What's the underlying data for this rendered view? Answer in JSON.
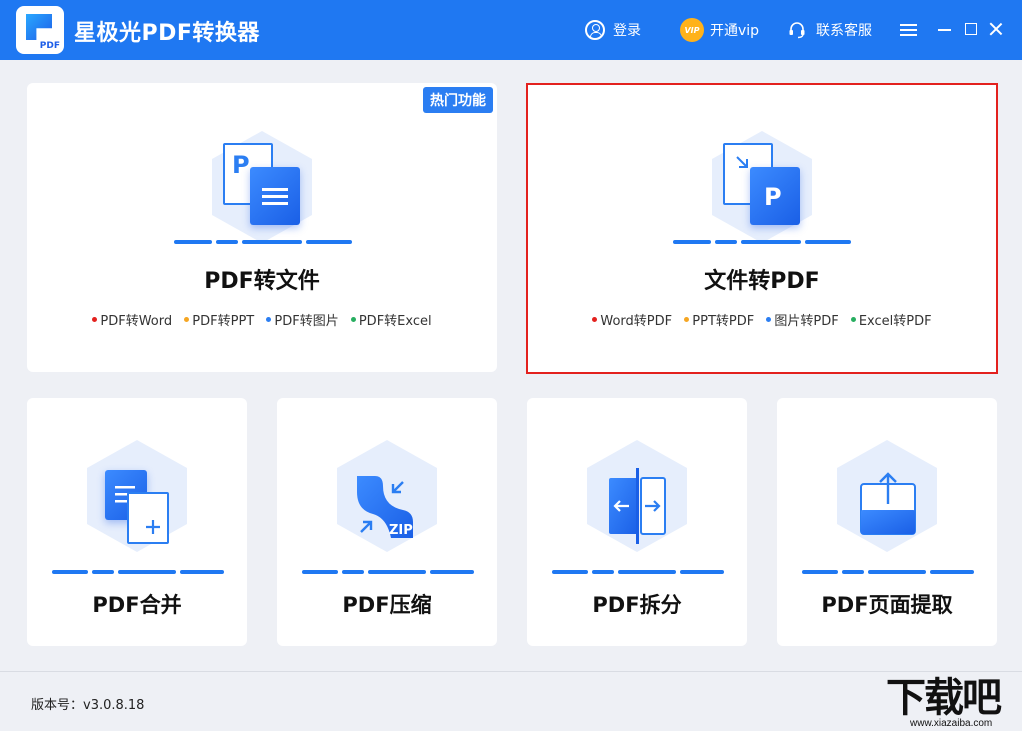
{
  "app": {
    "title": "星极光PDF转换器",
    "logo_text": "PDF"
  },
  "titlebar": {
    "login_label": "登录",
    "vip_badge": "VIP",
    "vip_label": "开通vip",
    "support_label": "联系客服"
  },
  "cards": {
    "pdf_to_file": {
      "title": "PDF转文件",
      "badge": "热门功能",
      "items": [
        {
          "label": "PDF转Word",
          "color": "#e3211e"
        },
        {
          "label": "PDF转PPT",
          "color": "#f5a623"
        },
        {
          "label": "PDF转图片",
          "color": "#2b7ef2"
        },
        {
          "label": "PDF转Excel",
          "color": "#27ae60"
        }
      ]
    },
    "file_to_pdf": {
      "title": "文件转PDF",
      "items": [
        {
          "label": "Word转PDF",
          "color": "#e3211e"
        },
        {
          "label": "PPT转PDF",
          "color": "#f5a623"
        },
        {
          "label": "图片转PDF",
          "color": "#2b7ef2"
        },
        {
          "label": "Excel转PDF",
          "color": "#27ae60"
        }
      ]
    },
    "merge": {
      "title": "PDF合并"
    },
    "compress": {
      "title": "PDF压缩",
      "icon_text": "ZIP"
    },
    "split": {
      "title": "PDF拆分"
    },
    "extract": {
      "title": "PDF页面提取"
    }
  },
  "footer": {
    "version": "版本号：v3.0.8.18"
  },
  "watermark": {
    "big": "下载吧",
    "small": "www.xiazaiba.com"
  },
  "colors": {
    "brand": "#1f78f2",
    "selected_border": "#e3211e",
    "background": "#eef0f5"
  }
}
